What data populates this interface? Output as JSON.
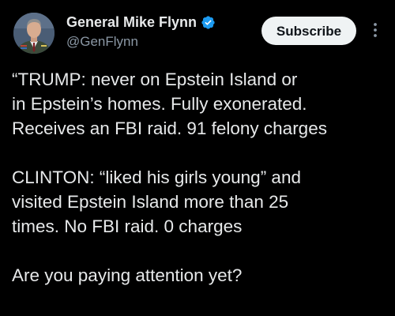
{
  "author": {
    "display_name": "General Mike Flynn",
    "handle": "@GenFlynn",
    "verified_icon": "verified-badge-icon",
    "verified_color": "#1d9bf0"
  },
  "actions": {
    "subscribe_label": "Subscribe",
    "more_icon": "more-options-icon"
  },
  "tweet": {
    "paragraphs": [
      {
        "lines": [
          "“TRUMP: never on Epstein Island or",
          "in Epstein’s homes. Fully exonerated.",
          "Receives an FBI raid. 91 felony charges"
        ]
      },
      {
        "lines": [
          "CLINTON: “liked his girls young” and",
          "visited Epstein Island more than 25",
          "times. No FBI raid. 0 charges"
        ]
      },
      {
        "lines": [
          "Are you paying attention yet?"
        ]
      }
    ]
  },
  "colors": {
    "background": "#000000",
    "text_primary": "#e7e9ea",
    "text_secondary": "#8b98a5",
    "button_bg": "#eff3f4",
    "button_text": "#0f1419"
  }
}
